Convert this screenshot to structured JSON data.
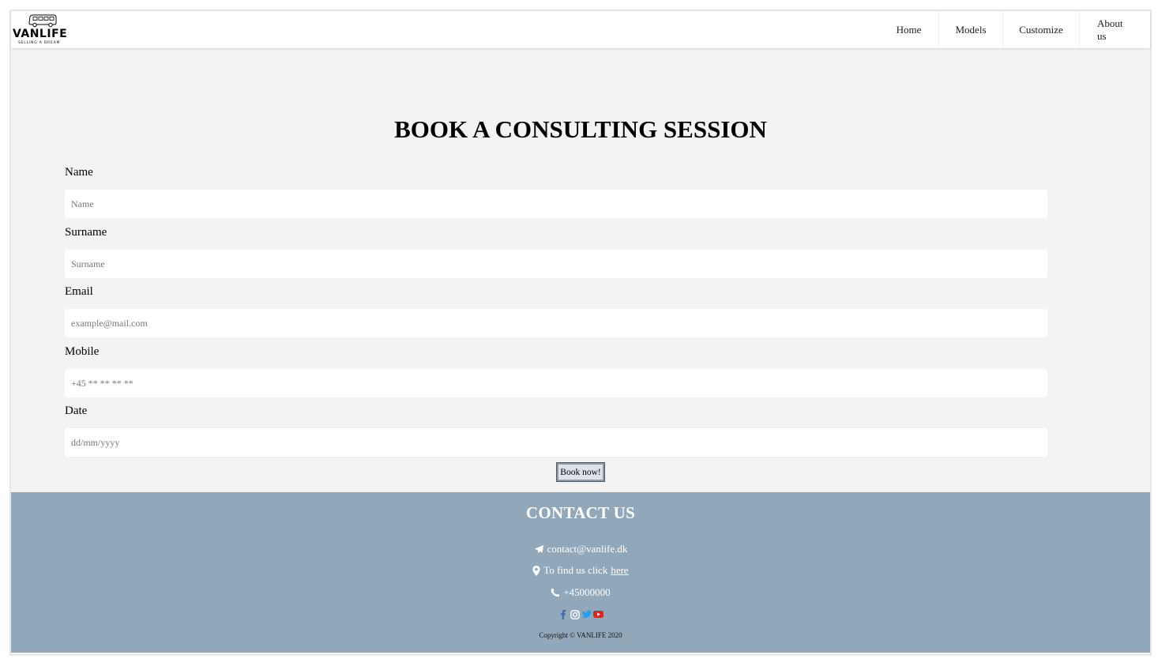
{
  "header": {
    "logo_text": "VANLIFE",
    "logo_tagline": "SELLING A DREAM",
    "nav": [
      {
        "label": "Home"
      },
      {
        "label": "Models"
      },
      {
        "label": "Customize"
      },
      {
        "label": "About us"
      }
    ]
  },
  "main": {
    "title": "BOOK A CONSULTING SESSION",
    "fields": [
      {
        "label": "Name",
        "placeholder": "Name",
        "value": ""
      },
      {
        "label": "Surname",
        "placeholder": "Surname",
        "value": ""
      },
      {
        "label": "Email",
        "placeholder": "example@mail.com",
        "value": ""
      },
      {
        "label": "Mobile",
        "placeholder": "+45 ** ** ** **",
        "value": ""
      },
      {
        "label": "Date",
        "placeholder": "dd/mm/yyyy",
        "value": ""
      }
    ],
    "submit_label": "Book now!"
  },
  "footer": {
    "title": "CONTACT US",
    "email": "contact@vanlife.dk",
    "find_us_text": "To find us click",
    "find_us_link": "here",
    "phone": "+45000000",
    "socials": [
      {
        "name": "facebook-icon",
        "color": "#4267b2"
      },
      {
        "name": "instagram-icon",
        "color": "#ffffff"
      },
      {
        "name": "twitter-icon",
        "color": "#1da1f2"
      },
      {
        "name": "youtube-icon",
        "color": "#e62117"
      }
    ],
    "copyright": "Copyright © VANLIFE 2020"
  },
  "colors": {
    "page_background": "#f3f3f3",
    "footer_background": "#91a8ba"
  }
}
